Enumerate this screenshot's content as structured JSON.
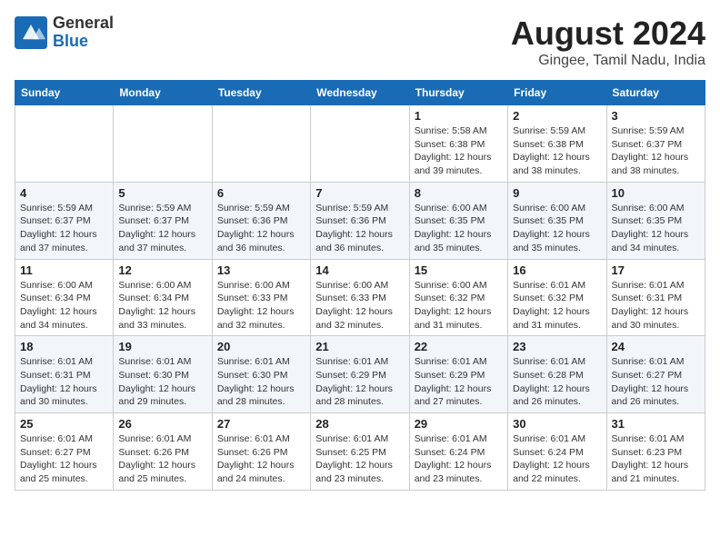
{
  "header": {
    "logo_line1": "General",
    "logo_line2": "Blue",
    "title": "August 2024",
    "subtitle": "Gingee, Tamil Nadu, India"
  },
  "weekdays": [
    "Sunday",
    "Monday",
    "Tuesday",
    "Wednesday",
    "Thursday",
    "Friday",
    "Saturday"
  ],
  "weeks": [
    [
      {
        "day": "",
        "info": ""
      },
      {
        "day": "",
        "info": ""
      },
      {
        "day": "",
        "info": ""
      },
      {
        "day": "",
        "info": ""
      },
      {
        "day": "1",
        "info": "Sunrise: 5:58 AM\nSunset: 6:38 PM\nDaylight: 12 hours and 39 minutes."
      },
      {
        "day": "2",
        "info": "Sunrise: 5:59 AM\nSunset: 6:38 PM\nDaylight: 12 hours and 38 minutes."
      },
      {
        "day": "3",
        "info": "Sunrise: 5:59 AM\nSunset: 6:37 PM\nDaylight: 12 hours and 38 minutes."
      }
    ],
    [
      {
        "day": "4",
        "info": "Sunrise: 5:59 AM\nSunset: 6:37 PM\nDaylight: 12 hours and 37 minutes."
      },
      {
        "day": "5",
        "info": "Sunrise: 5:59 AM\nSunset: 6:37 PM\nDaylight: 12 hours and 37 minutes."
      },
      {
        "day": "6",
        "info": "Sunrise: 5:59 AM\nSunset: 6:36 PM\nDaylight: 12 hours and 36 minutes."
      },
      {
        "day": "7",
        "info": "Sunrise: 5:59 AM\nSunset: 6:36 PM\nDaylight: 12 hours and 36 minutes."
      },
      {
        "day": "8",
        "info": "Sunrise: 6:00 AM\nSunset: 6:35 PM\nDaylight: 12 hours and 35 minutes."
      },
      {
        "day": "9",
        "info": "Sunrise: 6:00 AM\nSunset: 6:35 PM\nDaylight: 12 hours and 35 minutes."
      },
      {
        "day": "10",
        "info": "Sunrise: 6:00 AM\nSunset: 6:35 PM\nDaylight: 12 hours and 34 minutes."
      }
    ],
    [
      {
        "day": "11",
        "info": "Sunrise: 6:00 AM\nSunset: 6:34 PM\nDaylight: 12 hours and 34 minutes."
      },
      {
        "day": "12",
        "info": "Sunrise: 6:00 AM\nSunset: 6:34 PM\nDaylight: 12 hours and 33 minutes."
      },
      {
        "day": "13",
        "info": "Sunrise: 6:00 AM\nSunset: 6:33 PM\nDaylight: 12 hours and 32 minutes."
      },
      {
        "day": "14",
        "info": "Sunrise: 6:00 AM\nSunset: 6:33 PM\nDaylight: 12 hours and 32 minutes."
      },
      {
        "day": "15",
        "info": "Sunrise: 6:00 AM\nSunset: 6:32 PM\nDaylight: 12 hours and 31 minutes."
      },
      {
        "day": "16",
        "info": "Sunrise: 6:01 AM\nSunset: 6:32 PM\nDaylight: 12 hours and 31 minutes."
      },
      {
        "day": "17",
        "info": "Sunrise: 6:01 AM\nSunset: 6:31 PM\nDaylight: 12 hours and 30 minutes."
      }
    ],
    [
      {
        "day": "18",
        "info": "Sunrise: 6:01 AM\nSunset: 6:31 PM\nDaylight: 12 hours and 30 minutes."
      },
      {
        "day": "19",
        "info": "Sunrise: 6:01 AM\nSunset: 6:30 PM\nDaylight: 12 hours and 29 minutes."
      },
      {
        "day": "20",
        "info": "Sunrise: 6:01 AM\nSunset: 6:30 PM\nDaylight: 12 hours and 28 minutes."
      },
      {
        "day": "21",
        "info": "Sunrise: 6:01 AM\nSunset: 6:29 PM\nDaylight: 12 hours and 28 minutes."
      },
      {
        "day": "22",
        "info": "Sunrise: 6:01 AM\nSunset: 6:29 PM\nDaylight: 12 hours and 27 minutes."
      },
      {
        "day": "23",
        "info": "Sunrise: 6:01 AM\nSunset: 6:28 PM\nDaylight: 12 hours and 26 minutes."
      },
      {
        "day": "24",
        "info": "Sunrise: 6:01 AM\nSunset: 6:27 PM\nDaylight: 12 hours and 26 minutes."
      }
    ],
    [
      {
        "day": "25",
        "info": "Sunrise: 6:01 AM\nSunset: 6:27 PM\nDaylight: 12 hours and 25 minutes."
      },
      {
        "day": "26",
        "info": "Sunrise: 6:01 AM\nSunset: 6:26 PM\nDaylight: 12 hours and 25 minutes."
      },
      {
        "day": "27",
        "info": "Sunrise: 6:01 AM\nSunset: 6:26 PM\nDaylight: 12 hours and 24 minutes."
      },
      {
        "day": "28",
        "info": "Sunrise: 6:01 AM\nSunset: 6:25 PM\nDaylight: 12 hours and 23 minutes."
      },
      {
        "day": "29",
        "info": "Sunrise: 6:01 AM\nSunset: 6:24 PM\nDaylight: 12 hours and 23 minutes."
      },
      {
        "day": "30",
        "info": "Sunrise: 6:01 AM\nSunset: 6:24 PM\nDaylight: 12 hours and 22 minutes."
      },
      {
        "day": "31",
        "info": "Sunrise: 6:01 AM\nSunset: 6:23 PM\nDaylight: 12 hours and 21 minutes."
      }
    ]
  ]
}
